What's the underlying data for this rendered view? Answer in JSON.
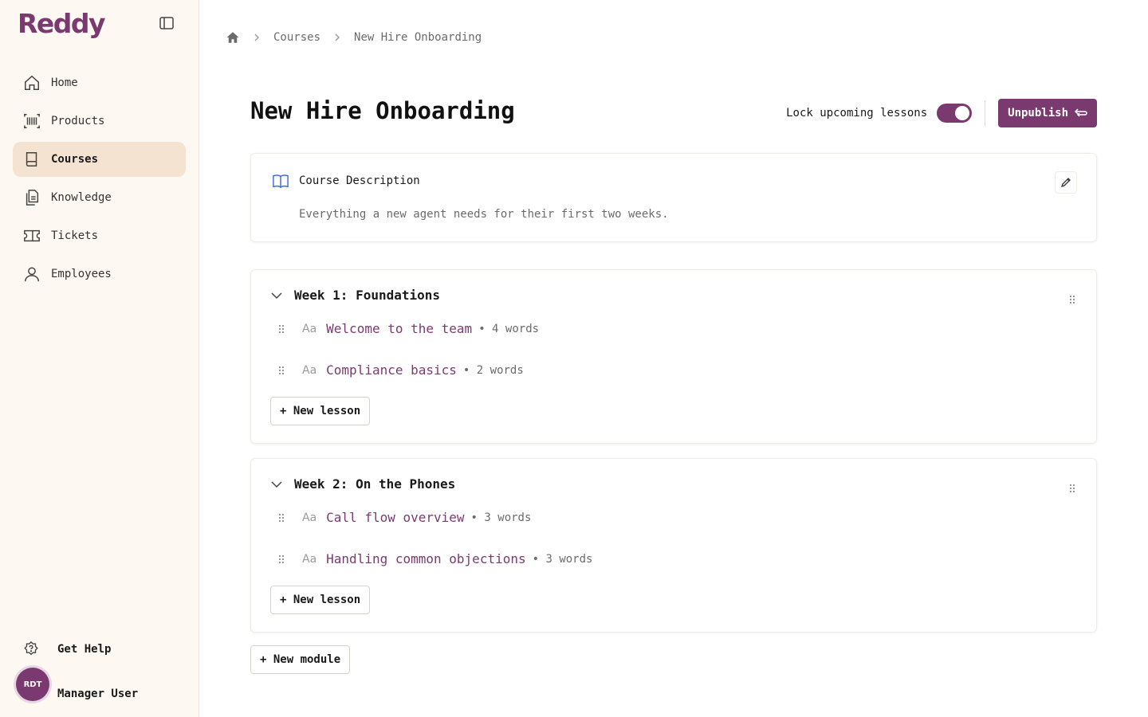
{
  "app": {
    "logo": "Reddy"
  },
  "sidebar": {
    "items": [
      {
        "label": "Home",
        "icon": "home-icon"
      },
      {
        "label": "Products",
        "icon": "barcode-icon"
      },
      {
        "label": "Courses",
        "icon": "book-icon",
        "active": true
      },
      {
        "label": "Knowledge",
        "icon": "documents-icon"
      },
      {
        "label": "Tickets",
        "icon": "ticket-icon"
      },
      {
        "label": "Employees",
        "icon": "user-icon"
      }
    ],
    "help_label": "Get Help",
    "user": {
      "initials": "RDT",
      "name": "Manager User"
    }
  },
  "breadcrumb": {
    "items": [
      "Courses",
      "New Hire Onboarding"
    ]
  },
  "page": {
    "title": "New Hire Onboarding",
    "lock_label": "Lock upcoming lessons",
    "lock_enabled": true,
    "unpublish_label": "Unpublish"
  },
  "description": {
    "heading": "Course Description",
    "text": "Everything a new agent needs for their first two weeks."
  },
  "modules": [
    {
      "title": "Week 1: Foundations",
      "lessons": [
        {
          "name": "Welcome to the team",
          "meta": "• 4 words",
          "type": "Aa"
        },
        {
          "name": "Compliance basics",
          "meta": "• 2 words",
          "type": "Aa"
        }
      ],
      "new_lesson_label": "+ New lesson"
    },
    {
      "title": "Week 2: On the Phones",
      "lessons": [
        {
          "name": "Call flow overview",
          "meta": "• 3 words",
          "type": "Aa"
        },
        {
          "name": "Handling common objections",
          "meta": "• 3 words",
          "type": "Aa"
        }
      ],
      "new_lesson_label": "+ New lesson"
    }
  ],
  "new_module_label": "+ New module",
  "colors": {
    "brand": "#7a3a70",
    "sidebar_bg": "#fdf8f1",
    "active_nav": "#f4e3d0"
  }
}
